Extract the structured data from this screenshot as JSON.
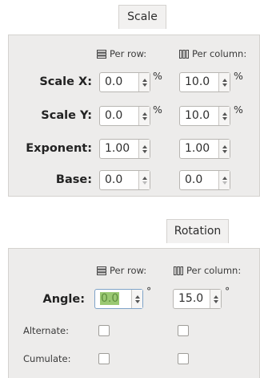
{
  "scale": {
    "tab_label": "Scale",
    "per_row_label": "Per row:",
    "per_column_label": "Per column:",
    "rows": [
      {
        "label": "Scale X:",
        "row_value": "0.0",
        "row_unit": "%",
        "col_value": "10.0",
        "col_unit": "%"
      },
      {
        "label": "Scale Y:",
        "row_value": "0.0",
        "row_unit": "%",
        "col_value": "10.0",
        "col_unit": "%"
      },
      {
        "label": "Exponent:",
        "row_value": "1.00",
        "row_unit": "",
        "col_value": "1.00",
        "col_unit": ""
      },
      {
        "label": "Base:",
        "row_value": "0.0",
        "row_unit": "",
        "col_value": "0.0",
        "col_unit": ""
      }
    ]
  },
  "rotation": {
    "tab_label": "Rotation",
    "per_row_label": "Per row:",
    "per_column_label": "Per column:",
    "angle_label": "Angle:",
    "angle_row_value": "0.0",
    "angle_col_value": "15.0",
    "angle_unit": "°",
    "alternate_label": "Alternate:",
    "cumulate_label": "Cumulate:",
    "alternate_row_checked": false,
    "alternate_col_checked": false,
    "cumulate_row_checked": false,
    "cumulate_col_checked": false
  },
  "icons": {
    "per_row": "rows-icon",
    "per_column": "columns-icon"
  },
  "colors": {
    "panel_bg": "#edeceb",
    "selection_bg": "#9ac872"
  }
}
